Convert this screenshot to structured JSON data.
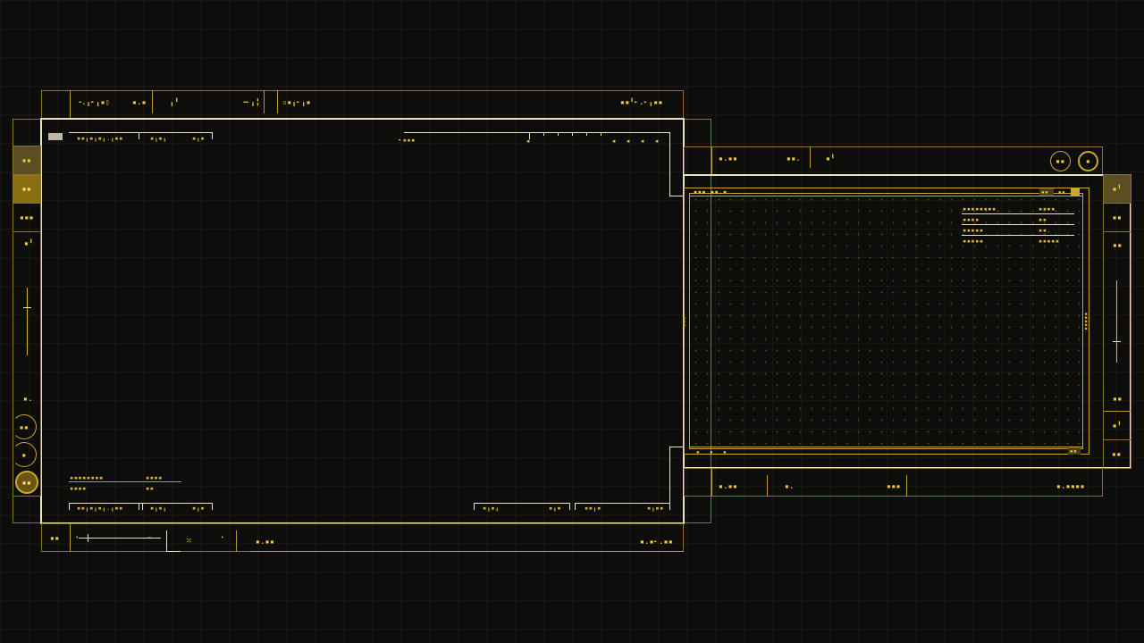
{
  "colors": {
    "background": "#0d0d0c",
    "accent": "#f0c740",
    "frame_line": "#e9e2c6",
    "dim_line": "#8a7424"
  },
  "main_panel": {
    "top_bar": {
      "seg1": "╺.╻╸╻▪▯",
      "seg1_value": "▪.▪",
      "seg2": "╻╹",
      "seg2_value": "╺╸╻╏",
      "seg3": "▫▪╻╸╻▪",
      "seg4": "▪▪╹╸.╸╻▪▪"
    },
    "header_tabs": [
      "▪▪╻▪╻▪╻.╻▪▪",
      "▪╻▪╻",
      "▪╻▪"
    ],
    "ruler_label": "╸▪▪▪",
    "ruler_ticks": [
      "▪",
      "▪",
      "▪",
      "▪",
      "▪"
    ],
    "readout_rows": [
      {
        "label": "▪▪▪▪▪▪▪▪",
        "value": "▪▪▪▪"
      },
      {
        "label": "▪▪▪▪",
        "value": "▪▪"
      }
    ],
    "footer_tabs_left": [
      "▪▪╻▪╻▪╻.╻▪▪",
      "▪╻▪╻",
      "▪╻▪"
    ],
    "footer_tabs_right": [
      "▪╻▪╻",
      "▪╻▪",
      "▪▪╻▪",
      "▪╻▪▪"
    ],
    "bottom_bar": {
      "code": "▪▪",
      "slider_icon": "◂—▸",
      "mark": "⁙",
      "value": "▪.▪▪",
      "right": "▪.▪╸.▪▪"
    },
    "left_sidebar": [
      "▪▪",
      "▪▪",
      "▪▪▪",
      "▪╹",
      "▪.",
      "▪▪",
      "▪",
      "▪▪"
    ]
  },
  "secondary_panel": {
    "top_bar": {
      "seg1": "▪.▪▪",
      "seg2": "▪▪.",
      "seg3": "▪╹",
      "circle1": "▪▪",
      "circle2": "▪"
    },
    "title": "▪▪▪ ▪▪.▪",
    "title_tags": [
      "▪▪",
      "▪▪",
      "▪"
    ],
    "vertical_left": "▪▪▪",
    "vertical_right": "▪▪▪▪▪",
    "stats": [
      {
        "label": "▪▪▪▪▪▪▪▪",
        "value": "▪▪▪▪"
      },
      {
        "label": "▪▪▪▪",
        "value": "▪▪"
      },
      {
        "label": "▪▪▪▪▪",
        "value": "▪▪."
      },
      {
        "label": "▪▪▪▪▪",
        "value": "▪▪▪▪▪"
      }
    ],
    "footer_marks": [
      "▪",
      "▪",
      "▪"
    ],
    "footer_right": "▪▪",
    "bottom_bar": {
      "seg1": "▪.▪▪",
      "seg2": "▪.",
      "seg3": "▪▪▪",
      "seg4": "▪.▪▪▪▪"
    },
    "right_sidebar": [
      "▪╹",
      "▪▪",
      "▪▪",
      "▪▪",
      "▪╹",
      "▪▪"
    ]
  }
}
